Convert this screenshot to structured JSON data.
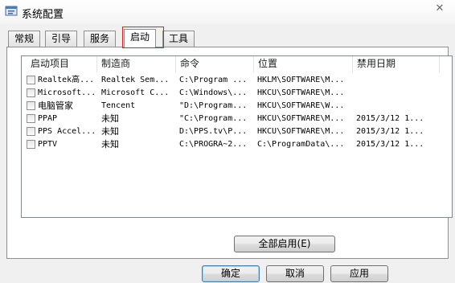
{
  "window": {
    "title": "系统配置"
  },
  "tabs": [
    {
      "label": "常规"
    },
    {
      "label": "引导"
    },
    {
      "label": "服务"
    },
    {
      "label": "启动"
    },
    {
      "label": "工具"
    }
  ],
  "list": {
    "columns": [
      "启动项目",
      "制造商",
      "命令",
      "位置",
      "禁用日期"
    ],
    "rows": [
      {
        "item": "Realtek高...",
        "maker": "Realtek Sem...",
        "command": "C:\\Program ...",
        "location": "HKLM\\SOFTWARE\\M...",
        "date": ""
      },
      {
        "item": "Microsoft...",
        "maker": "Microsoft C...",
        "command": "C:\\Windows\\...",
        "location": "HKCU\\SOFTWARE\\M...",
        "date": ""
      },
      {
        "item": "电脑管家",
        "maker": "Tencent",
        "command": "\"D:\\Program...",
        "location": "HKCU\\SOFTWARE\\W...",
        "date": ""
      },
      {
        "item": "PPAP",
        "maker": "未知",
        "command": "\"C:\\Program...",
        "location": "HKCU\\SOFTWARE\\M...",
        "date": "2015/3/12 1..."
      },
      {
        "item": "PPS Accel...",
        "maker": "未知",
        "command": "D:\\PPS.tv\\P...",
        "location": "HKCU\\SOFTWARE\\M...",
        "date": "2015/3/12 1..."
      },
      {
        "item": "PPTV",
        "maker": "未知",
        "command": "C:\\PROGRA~2...",
        "location": "C:\\ProgramData\\...",
        "date": "2015/3/12 1..."
      }
    ]
  },
  "buttons": {
    "enable_all": "全部启用(E)",
    "ok": "确定",
    "cancel": "取消",
    "apply": "应用"
  },
  "icons": {
    "title": "settings-window-icon",
    "close": "close-icon"
  }
}
